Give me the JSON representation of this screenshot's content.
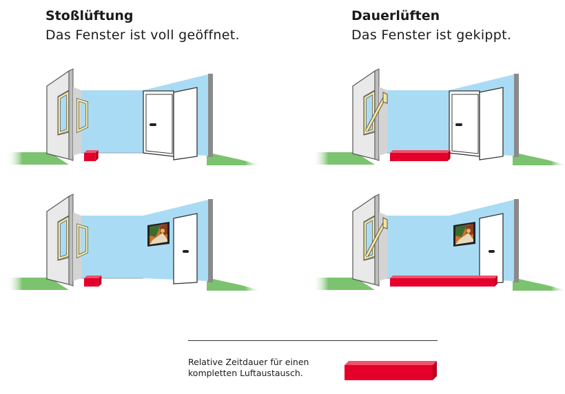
{
  "columns": [
    {
      "title": "Stoßlüftung",
      "subtitle": "Das Fenster ist voll geöffnet."
    },
    {
      "title": "Dauerlüften",
      "subtitle": "Das Fenster ist gekippt."
    }
  ],
  "scenes": [
    {
      "window": "open",
      "door": "open",
      "picture": false,
      "relative_duration": 0.11
    },
    {
      "window": "tilted",
      "door": "open",
      "picture": false,
      "relative_duration": 0.55
    },
    {
      "window": "open",
      "door": "closed",
      "picture": true,
      "relative_duration": 0.14
    },
    {
      "window": "tilted",
      "door": "closed",
      "picture": true,
      "relative_duration": 1.0
    }
  ],
  "legend": {
    "line1": "Relative Zeitdauer für einen",
    "line2": "kompletten Luftaustausch."
  },
  "colors": {
    "wall": "#a9dcf4",
    "wall_edge": "#8a8a8a",
    "side_wall": "#e9e9e9",
    "floor": "#7cc36f",
    "frame": "#f4e6a0",
    "frame_edge": "#555555",
    "bar_top": "#f0526a",
    "bar_front": "#e4002b",
    "door": "#ffffff",
    "rule": "#333333"
  }
}
